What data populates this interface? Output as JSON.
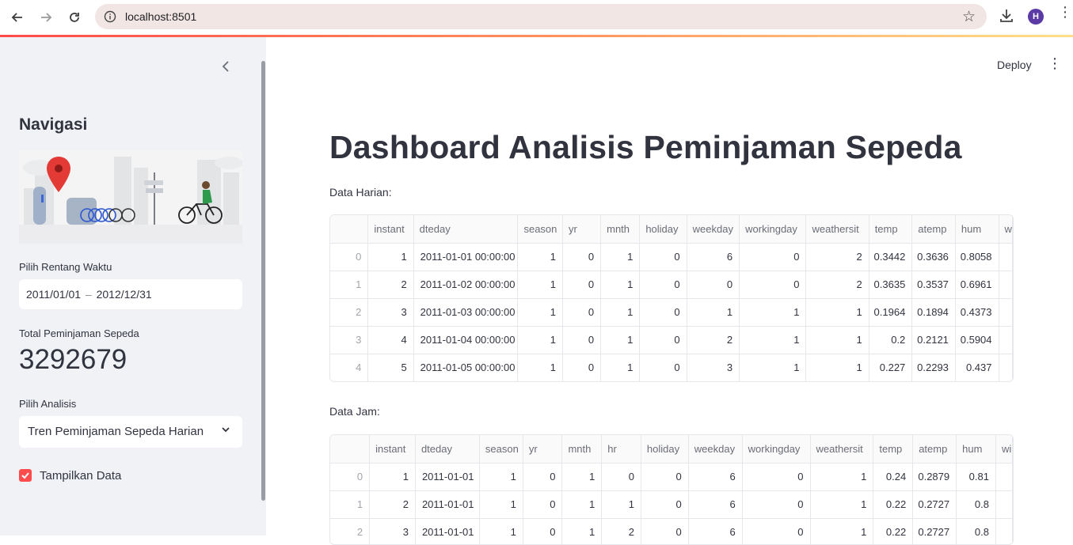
{
  "browser": {
    "url": "localhost:8501",
    "profile_initial": "H"
  },
  "sidebar": {
    "title": "Navigasi",
    "date_label": "Pilih Rentang Waktu",
    "date_start": "2011/01/01",
    "date_sep": "–",
    "date_end": "2012/12/31",
    "metric_label": "Total Peminjaman Sepeda",
    "metric_value": "3292679",
    "analysis_label": "Pilih Analisis",
    "analysis_value": "Tren Peminjaman Sepeda Harian",
    "checkbox_label": "Tampilkan Data",
    "checkbox_checked": true
  },
  "header": {
    "deploy_label": "Deploy"
  },
  "main": {
    "title": "Dashboard Analisis Peminjaman Sepeda",
    "daily_caption": "Data Harian:",
    "hourly_caption": "Data Jam:"
  },
  "daily_table": {
    "columns": [
      "",
      "instant",
      "dteday",
      "season",
      "yr",
      "mnth",
      "holiday",
      "weekday",
      "workingday",
      "weathersit",
      "temp",
      "atemp",
      "hum",
      "w"
    ],
    "rows": [
      [
        "0",
        "1",
        "2011-01-01 00:00:00",
        "1",
        "0",
        "1",
        "0",
        "6",
        "0",
        "2",
        "0.3442",
        "0.3636",
        "0.8058",
        ""
      ],
      [
        "1",
        "2",
        "2011-01-02 00:00:00",
        "1",
        "0",
        "1",
        "0",
        "0",
        "0",
        "2",
        "0.3635",
        "0.3537",
        "0.6961",
        ""
      ],
      [
        "2",
        "3",
        "2011-01-03 00:00:00",
        "1",
        "0",
        "1",
        "0",
        "1",
        "1",
        "1",
        "0.1964",
        "0.1894",
        "0.4373",
        ""
      ],
      [
        "3",
        "4",
        "2011-01-04 00:00:00",
        "1",
        "0",
        "1",
        "0",
        "2",
        "1",
        "1",
        "0.2",
        "0.2121",
        "0.5904",
        ""
      ],
      [
        "4",
        "5",
        "2011-01-05 00:00:00",
        "1",
        "0",
        "1",
        "0",
        "3",
        "1",
        "1",
        "0.227",
        "0.2293",
        "0.437",
        ""
      ]
    ]
  },
  "hourly_table": {
    "columns": [
      "",
      "instant",
      "dteday",
      "season",
      "yr",
      "mnth",
      "hr",
      "holiday",
      "weekday",
      "workingday",
      "weathersit",
      "temp",
      "atemp",
      "hum",
      "wi"
    ],
    "rows": [
      [
        "0",
        "1",
        "2011-01-01",
        "1",
        "0",
        "1",
        "0",
        "0",
        "6",
        "0",
        "1",
        "0.24",
        "0.2879",
        "0.81",
        ""
      ],
      [
        "1",
        "2",
        "2011-01-01",
        "1",
        "0",
        "1",
        "1",
        "0",
        "6",
        "0",
        "1",
        "0.22",
        "0.2727",
        "0.8",
        ""
      ],
      [
        "2",
        "3",
        "2011-01-01",
        "1",
        "0",
        "1",
        "2",
        "0",
        "6",
        "0",
        "1",
        "0.22",
        "0.2727",
        "0.8",
        ""
      ]
    ]
  }
}
